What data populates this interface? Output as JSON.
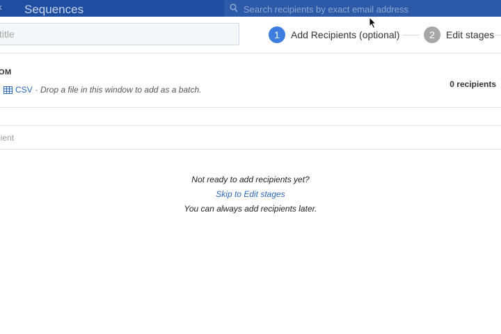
{
  "topbar": {
    "app_title": "Sequences",
    "search_placeholder": "Search recipients by exact email address",
    "back_icon": "chevron-left-icon"
  },
  "header": {
    "title_placeholder": "title",
    "steps": [
      {
        "number": "1",
        "label": "Add Recipients (optional)",
        "state": "active",
        "color": "#3d7ddf"
      },
      {
        "number": "2",
        "label": "Edit stages",
        "state": "inactive",
        "color": "#a7a7a7"
      }
    ]
  },
  "add_section": {
    "from_label": "OM",
    "csv_link": "CSV",
    "drop_hint": "· Drop a file in this window to add as a batch.",
    "recipients_count": "0 recipients",
    "recipient_placeholder": "pient"
  },
  "empty_state": {
    "line1": "Not ready to add recipients yet?",
    "skip_link": "Skip to Edit stages",
    "line3": "You can always add recipients later."
  },
  "colors": {
    "topbar": "#1f4ea0",
    "link": "#2b66b8",
    "active_step": "#3d7ddf"
  }
}
